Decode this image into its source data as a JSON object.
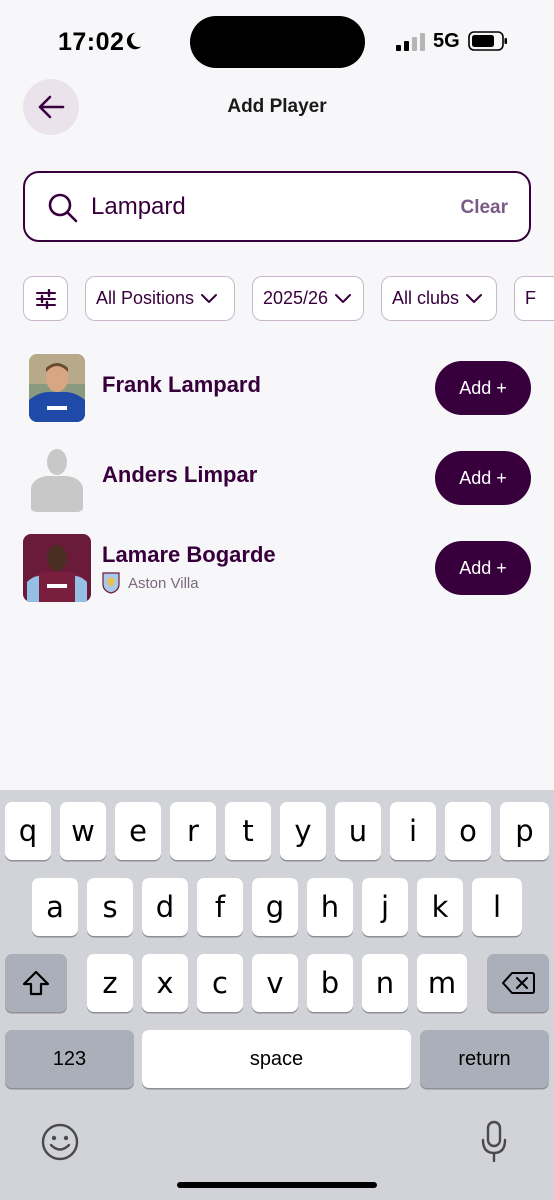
{
  "status_bar": {
    "time": "17:02",
    "network": "5G"
  },
  "header": {
    "title": "Add Player"
  },
  "search": {
    "value": "Lampard",
    "placeholder": "",
    "clear_label": "Clear"
  },
  "filters": {
    "positions": "All Positions",
    "season": "2025/26",
    "clubs": "All clubs",
    "partial": "F"
  },
  "players": [
    {
      "name": "Frank Lampard",
      "club": "",
      "add_label": "Add +"
    },
    {
      "name": "Anders Limpar",
      "club": "",
      "add_label": "Add +"
    },
    {
      "name": "Lamare Bogarde",
      "club": "Aston Villa",
      "add_label": "Add +"
    }
  ],
  "keyboard": {
    "row1": [
      "q",
      "w",
      "e",
      "r",
      "t",
      "y",
      "u",
      "i",
      "o",
      "p"
    ],
    "row2": [
      "a",
      "s",
      "d",
      "f",
      "g",
      "h",
      "j",
      "k",
      "l"
    ],
    "row3": [
      "z",
      "x",
      "c",
      "v",
      "b",
      "n",
      "m"
    ],
    "numbers_label": "123",
    "space_label": "space",
    "return_label": "return"
  },
  "colors": {
    "brand": "#37003c",
    "background": "#f7f6f8",
    "keyboard": "#d1d3d9"
  }
}
